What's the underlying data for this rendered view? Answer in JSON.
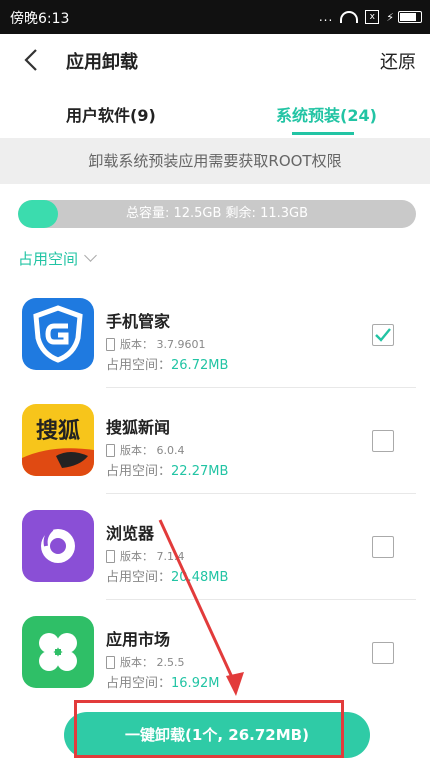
{
  "status_bar": {
    "time": "傍晚6:13",
    "dots": "...",
    "sim_mark": "x"
  },
  "app_bar": {
    "title": "应用卸载",
    "restore_label": "还原"
  },
  "tabs": [
    {
      "label": "用户软件(9)",
      "active": false
    },
    {
      "label": "系统预装(24)",
      "active": true
    }
  ],
  "notice": "卸载系统预装应用需要获取ROOT权限",
  "storage": {
    "text": "总容量: 12.5GB  剩余: 11.3GB",
    "used_fraction": 0.1
  },
  "sort_label": "占用空间",
  "apps": [
    {
      "name": "手机管家",
      "version": "版本： 3.7.9601",
      "size_label": "占用空间：",
      "size_value": "26.72MB",
      "checked": true,
      "icon": "shield-icon",
      "icon_text": ""
    },
    {
      "name": "搜狐新闻",
      "version": "版本： 6.0.4",
      "size_label": "占用空间：",
      "size_value": "22.27MB",
      "checked": false,
      "icon": "sohu-fox-icon",
      "icon_text": "搜狐"
    },
    {
      "name": "浏览器",
      "version": "版本： 7.1.4",
      "size_label": "占用空间：",
      "size_value": "20.48MB",
      "checked": false,
      "icon": "browser-icon",
      "icon_text": ""
    },
    {
      "name": "应用市场",
      "version": "版本： 2.5.5",
      "size_label": "占用空间：",
      "size_value": "16.92M",
      "checked": false,
      "icon": "clover-icon",
      "icon_text": ""
    }
  ],
  "uninstall_button": "一键卸载(1个, 26.72MB)",
  "colors": {
    "accent": "#22c4a4",
    "highlight": "#e23b3b"
  }
}
